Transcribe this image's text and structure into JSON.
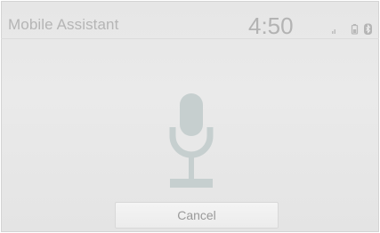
{
  "header": {
    "title": "Mobile Assistant",
    "time": "4:50"
  },
  "status_icons": [
    "signal-icon",
    "battery-icon",
    "bluetooth-icon"
  ],
  "main": {
    "icon": "microphone-icon"
  },
  "footer": {
    "cancel_label": "Cancel"
  },
  "colors": {
    "background": "#e6e6e6",
    "text": "#b5b5b5",
    "mic": "#c8cfcf",
    "button_bg": "#f0f0f0"
  }
}
